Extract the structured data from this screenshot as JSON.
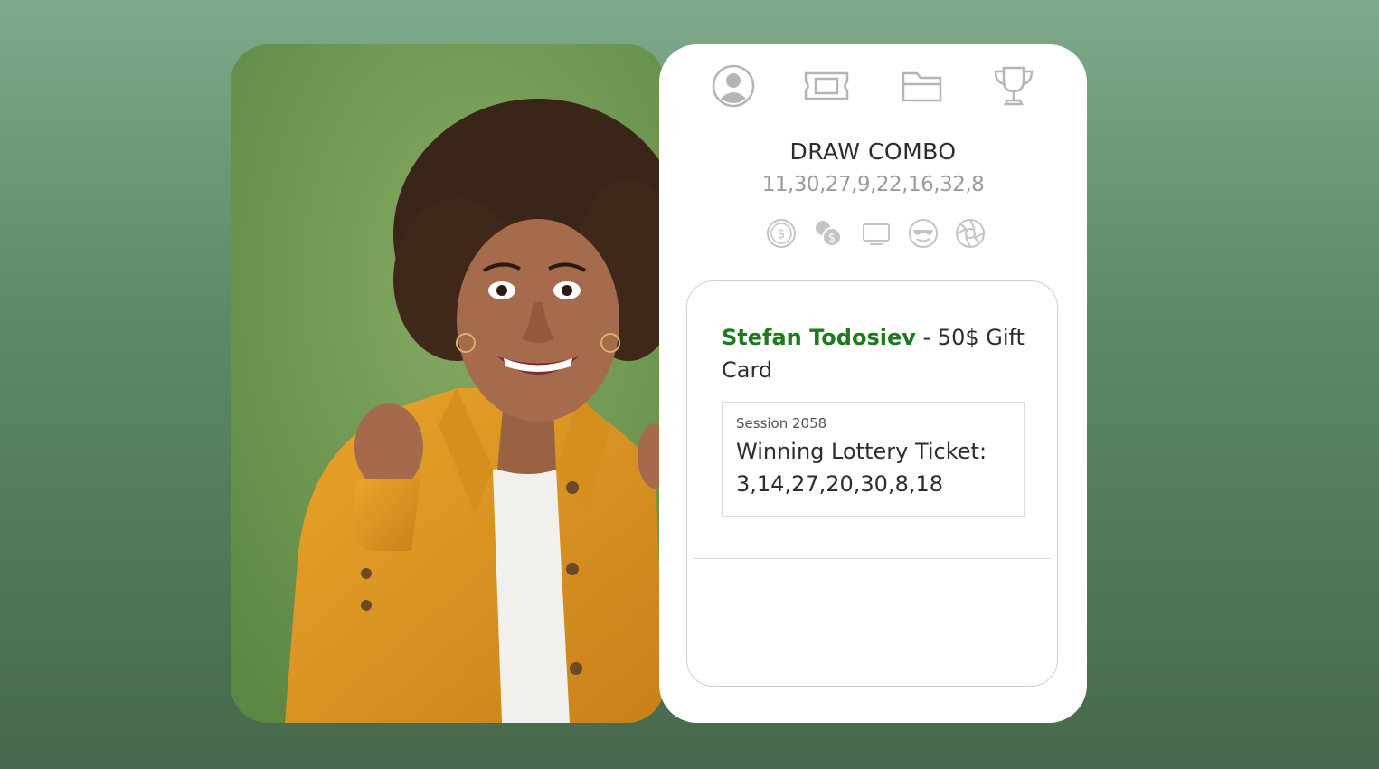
{
  "nav": {
    "icons": [
      "user-icon",
      "ticket-icon",
      "folder-icon",
      "trophy-icon"
    ]
  },
  "draw": {
    "title": "DRAW COMBO",
    "numbers": "11,30,27,9,22,16,32,8"
  },
  "prize_icons": [
    "dollar-coin-icon",
    "coins-icon",
    "monitor-icon",
    "sunglasses-smiley-icon",
    "aperture-icon"
  ],
  "winner": {
    "name": "Stefan Todosiev",
    "prize": " - 50$ Gift Card",
    "session": "Session 2058",
    "ticket": "Winning Lottery Ticket: 3,14,27,20,30,8,18"
  },
  "colors": {
    "accent": "#1d7a1d",
    "icon_gray": "#b5b5b5",
    "background_top": "#7fa98b",
    "background_bottom": "#47684c"
  }
}
